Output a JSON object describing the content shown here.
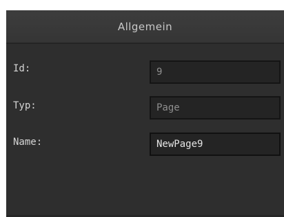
{
  "panel": {
    "title": "Allgemein"
  },
  "fields": {
    "id": {
      "label": "Id:",
      "value": "9"
    },
    "typ": {
      "label": "Typ:",
      "value": "Page"
    },
    "name": {
      "label": "Name:",
      "value": "NewPage9"
    }
  }
}
